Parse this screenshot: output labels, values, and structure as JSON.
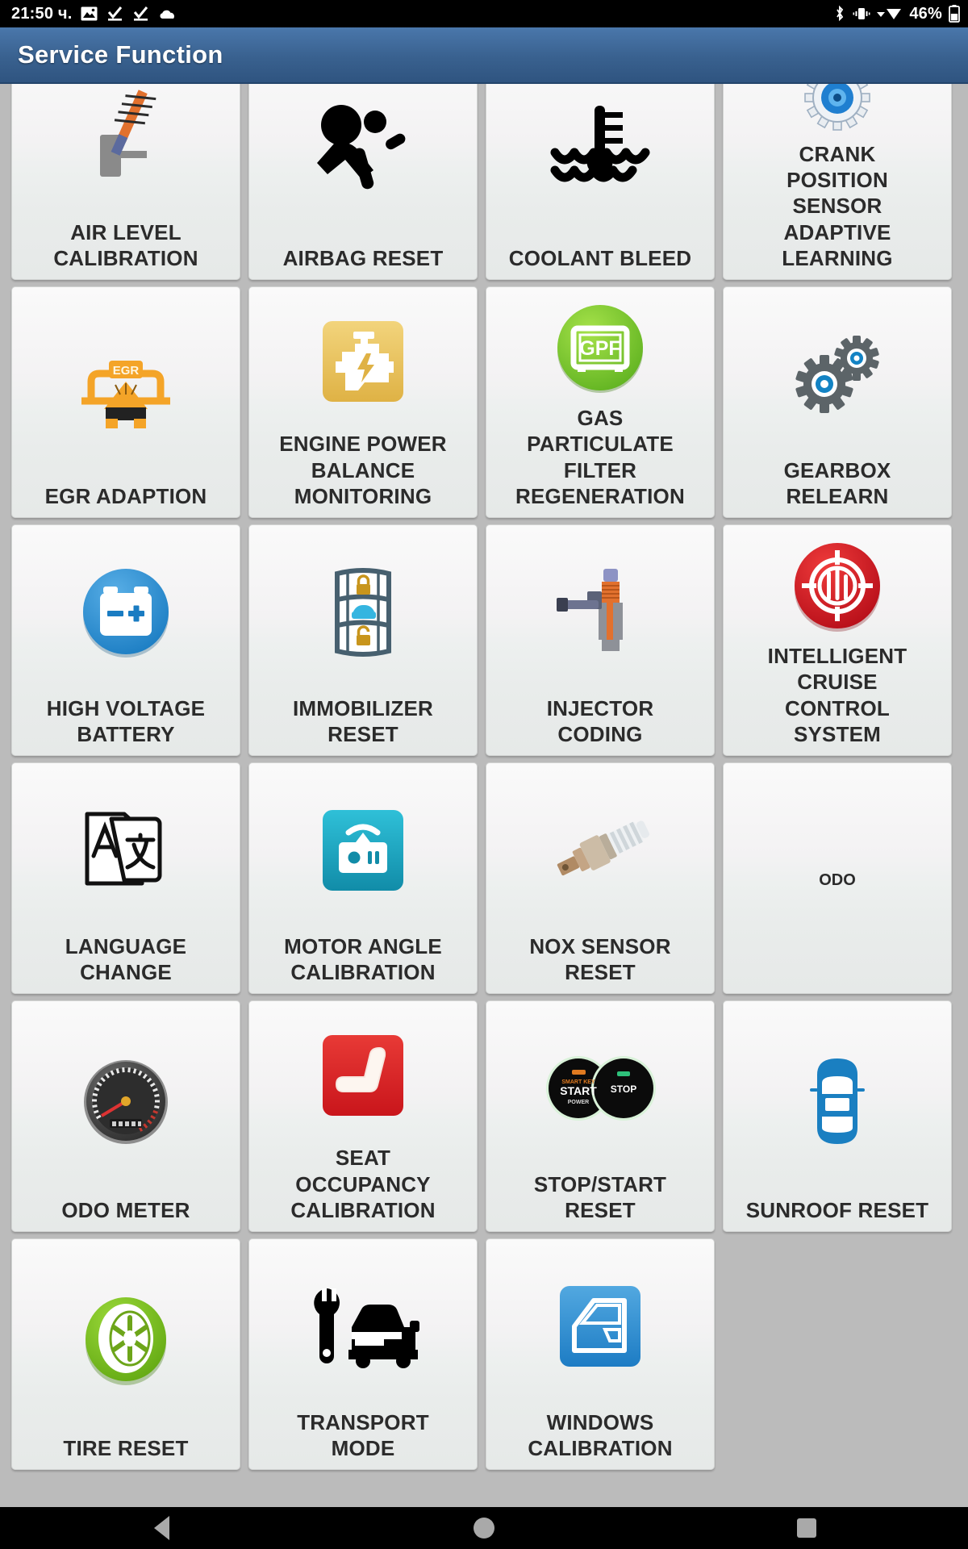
{
  "status_bar": {
    "time": "21:50 ч.",
    "battery_percent": "46%",
    "left_icons": [
      "image-icon",
      "download-complete-icon",
      "download-complete-icon",
      "cloud-icon"
    ],
    "right_icons": [
      "bluetooth-icon",
      "vibrate-icon",
      "wifi-icon",
      "battery-icon"
    ]
  },
  "title_bar": {
    "title": "Service Function",
    "background_color": "#39618f"
  },
  "grid": {
    "columns": 4,
    "items": [
      {
        "label": "AIR LEVEL\nCALIBRATION",
        "icon": "air-level-calibration-icon"
      },
      {
        "label": "AIRBAG RESET",
        "icon": "airbag-reset-icon"
      },
      {
        "label": "COOLANT BLEED",
        "icon": "coolant-bleed-icon"
      },
      {
        "label": "CRANK\nPOSITION\nSENSOR\nADAPTIVE\nLEARNING",
        "icon": "crank-position-sensor-icon"
      },
      {
        "label": "EGR ADAPTION",
        "icon": "egr-adaption-icon"
      },
      {
        "label": "ENGINE POWER\nBALANCE\nMONITORING",
        "icon": "engine-power-balance-icon"
      },
      {
        "label": "GAS\nPARTICULATE\nFILTER\nREGENERATION",
        "icon": "gpf-regeneration-icon"
      },
      {
        "label": "GEARBOX\nRELEARN",
        "icon": "gearbox-relearn-icon"
      },
      {
        "label": "HIGH VOLTAGE\nBATTERY",
        "icon": "high-voltage-battery-icon"
      },
      {
        "label": "IMMOBILIZER\nRESET",
        "icon": "immobilizer-reset-icon"
      },
      {
        "label": "INJECTOR\nCODING",
        "icon": "injector-coding-icon"
      },
      {
        "label": "INTELLIGENT\nCRUISE\nCONTROL\nSYSTEM",
        "icon": "intelligent-cruise-control-icon"
      },
      {
        "label": "LANGUAGE\nCHANGE",
        "icon": "language-change-icon"
      },
      {
        "label": "MOTOR ANGLE\nCALIBRATION",
        "icon": "motor-angle-calibration-icon"
      },
      {
        "label": "NOX SENSOR\nRESET",
        "icon": "nox-sensor-icon"
      },
      {
        "label": "ODO",
        "icon": "none",
        "text_only": true
      },
      {
        "label": "ODO METER",
        "icon": "odo-meter-icon"
      },
      {
        "label": "SEAT\nOCCUPANCY\nCALIBRATION",
        "icon": "seat-occupancy-icon"
      },
      {
        "label": "STOP/START\nRESET",
        "icon": "stop-start-icon"
      },
      {
        "label": "SUNROOF RESET",
        "icon": "sunroof-icon"
      },
      {
        "label": "TIRE RESET",
        "icon": "tire-reset-icon"
      },
      {
        "label": "TRANSPORT\nMODE",
        "icon": "transport-mode-icon"
      },
      {
        "label": "WINDOWS\nCALIBRATION",
        "icon": "windows-calibration-icon"
      }
    ]
  },
  "nav_bar": {
    "buttons": [
      "back-button",
      "home-button",
      "recents-button"
    ]
  }
}
